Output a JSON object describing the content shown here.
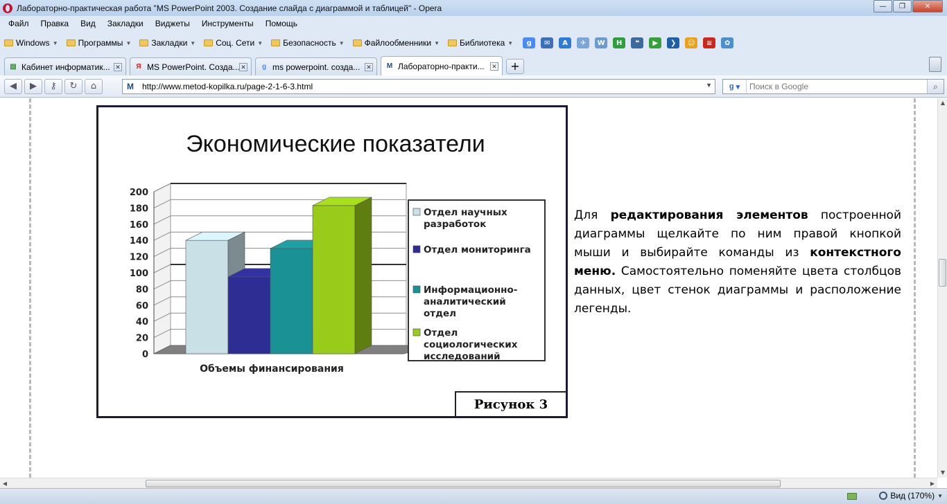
{
  "window": {
    "title": "Лабораторно-практическая работа \"MS PowerPoint 2003. Создание слайда с диаграммой и таблицей\" - Opera",
    "controls": {
      "minimize": "—",
      "restore": "❐",
      "close": "✕"
    }
  },
  "menu": [
    "Файл",
    "Правка",
    "Вид",
    "Закладки",
    "Виджеты",
    "Инструменты",
    "Помощь"
  ],
  "bookmarks": {
    "folders": [
      "Windows",
      "Программы",
      "Закладки",
      "Соц. Сети",
      "Безопасность",
      "Файлообменники",
      "Библиотека"
    ],
    "quick_icons": [
      {
        "icon": "google-icon",
        "glyph": "g",
        "color": "#4a8af4"
      },
      {
        "icon": "mail-icon",
        "glyph": "✉",
        "color": "#3c6fb7"
      },
      {
        "icon": "translate-icon",
        "glyph": "A",
        "color": "#2f7bd6"
      },
      {
        "icon": "bird-icon",
        "glyph": "✈",
        "color": "#7aa7d8"
      },
      {
        "icon": "wikipedia-icon",
        "glyph": "W",
        "color": "#6b9bd2"
      },
      {
        "icon": "h-icon",
        "glyph": "H",
        "color": "#2e9e3e"
      },
      {
        "icon": "quote-icon",
        "glyph": "❝",
        "color": "#3d6a9e"
      },
      {
        "icon": "play-icon",
        "glyph": "▶",
        "color": "#35a03c"
      },
      {
        "icon": "forward-icon",
        "glyph": "❯",
        "color": "#1f5fa8"
      },
      {
        "icon": "smiley-icon",
        "glyph": "☺",
        "color": "#e8a21d"
      },
      {
        "icon": "flag-icon",
        "glyph": "≡",
        "color": "#c8281e"
      },
      {
        "icon": "flower-icon",
        "glyph": "✿",
        "color": "#4a90d0"
      }
    ]
  },
  "tabs": [
    {
      "favicon": "page-icon",
      "glyph": "▤",
      "color": "#3b8a3b",
      "label": "Кабинет информатик...",
      "active": false
    },
    {
      "favicon": "yandex-icon",
      "glyph": "Я",
      "color": "#d82020",
      "label": "MS PowerPoint. Созда...",
      "active": false
    },
    {
      "favicon": "google-icon",
      "glyph": "g",
      "color": "#4a8af4",
      "label": "ms powerpoint. созда...",
      "active": false
    },
    {
      "favicon": "metod-kopilka-icon",
      "glyph": "M",
      "color": "#1d4a8a",
      "label": "Лабораторно-практи...",
      "active": true
    }
  ],
  "nav": {
    "back": "◀",
    "forward": "▶",
    "key": "⚷",
    "reload": "↻",
    "home": "⌂",
    "address_favicon": "M",
    "url": "http://www.metod-kopilka.ru/page-2-1-6-3.html",
    "search_engine": "g",
    "search_placeholder": "Поиск в Google",
    "search_go": "⌕"
  },
  "page": {
    "paragraph_parts": [
      {
        "text": "Для ",
        "bold": false
      },
      {
        "text": "редактирования элементов",
        "bold": true
      },
      {
        "text": " построенной диаграммы щелкайте по ним правой кнопкой мыши и выбирайте команды из ",
        "bold": false
      },
      {
        "text": "контекстного меню.",
        "bold": true
      },
      {
        "text": " Самостоятельно поменяйте цвета столбцов данных, цвет стенок диаграммы и расположение легенды.",
        "bold": false
      }
    ],
    "figure_caption": "Рисунок 3"
  },
  "chart_data": {
    "type": "bar",
    "title": "Экономические показатели",
    "categories": [
      "Объемы финансирования"
    ],
    "series": [
      {
        "name": "Отдел научных разработок",
        "values": [
          140
        ],
        "color": "#c8e0e6"
      },
      {
        "name": "Отдел мониторинга",
        "values": [
          95
        ],
        "color": "#2e2d94"
      },
      {
        "name": "Информационно-аналитический отдел",
        "values": [
          130
        ],
        "color": "#1a9295"
      },
      {
        "name": "Отдел социологических исследований",
        "values": [
          183
        ],
        "color": "#99cc1a"
      }
    ],
    "legend_lines": [
      [
        "Отдел научных",
        "разработок"
      ],
      [
        "Отдел мониторинга"
      ],
      [
        "Информационно-",
        "аналитический",
        "отдел"
      ],
      [
        "Отдел",
        "социологических",
        "исследований"
      ]
    ],
    "ylim": [
      0,
      200
    ],
    "yticks": [
      "0",
      "20",
      "40",
      "60",
      "80",
      "100",
      "120",
      "140",
      "160",
      "180",
      "200"
    ],
    "xlabel": "Объемы финансирования",
    "ylabel": "",
    "grid": true,
    "legend_position": "right",
    "style": "3d"
  },
  "status": {
    "zoom_label": "Вид (170%)"
  }
}
